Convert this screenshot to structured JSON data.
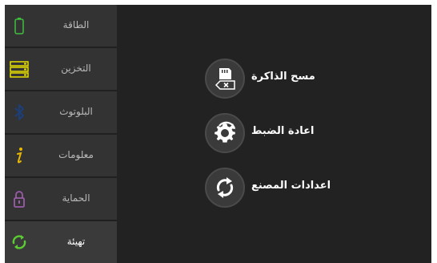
{
  "sidebar": {
    "items": [
      {
        "label": "الطاقة",
        "icon": "battery-icon",
        "icon_color": "#3fbf3f"
      },
      {
        "label": "التخزين",
        "icon": "storage-icon",
        "icon_color": "#e8e000"
      },
      {
        "label": "البلوتوث",
        "icon": "bluetooth-icon",
        "icon_color": "#1c3f7a"
      },
      {
        "label": "معلومات",
        "icon": "info-icon",
        "icon_color": "#e8b800"
      },
      {
        "label": "الحماية",
        "icon": "lock-icon",
        "icon_color": "#9a5ca8"
      },
      {
        "label": "تهيئة",
        "icon": "sync-icon",
        "icon_color": "#5ccc33"
      }
    ],
    "active_index": 5
  },
  "actions": [
    {
      "label": "مسح الذاكرة",
      "icon": "sd-card-clear-icon"
    },
    {
      "label": "اعادة الضبط",
      "icon": "gear-reset-icon"
    },
    {
      "label": "اعدادات المصنع",
      "icon": "refresh-icon"
    }
  ],
  "colors": {
    "background": "#262626",
    "sidebar_item": "#333333",
    "text_primary": "#ffffff",
    "text_muted": "#b9b9b9"
  }
}
